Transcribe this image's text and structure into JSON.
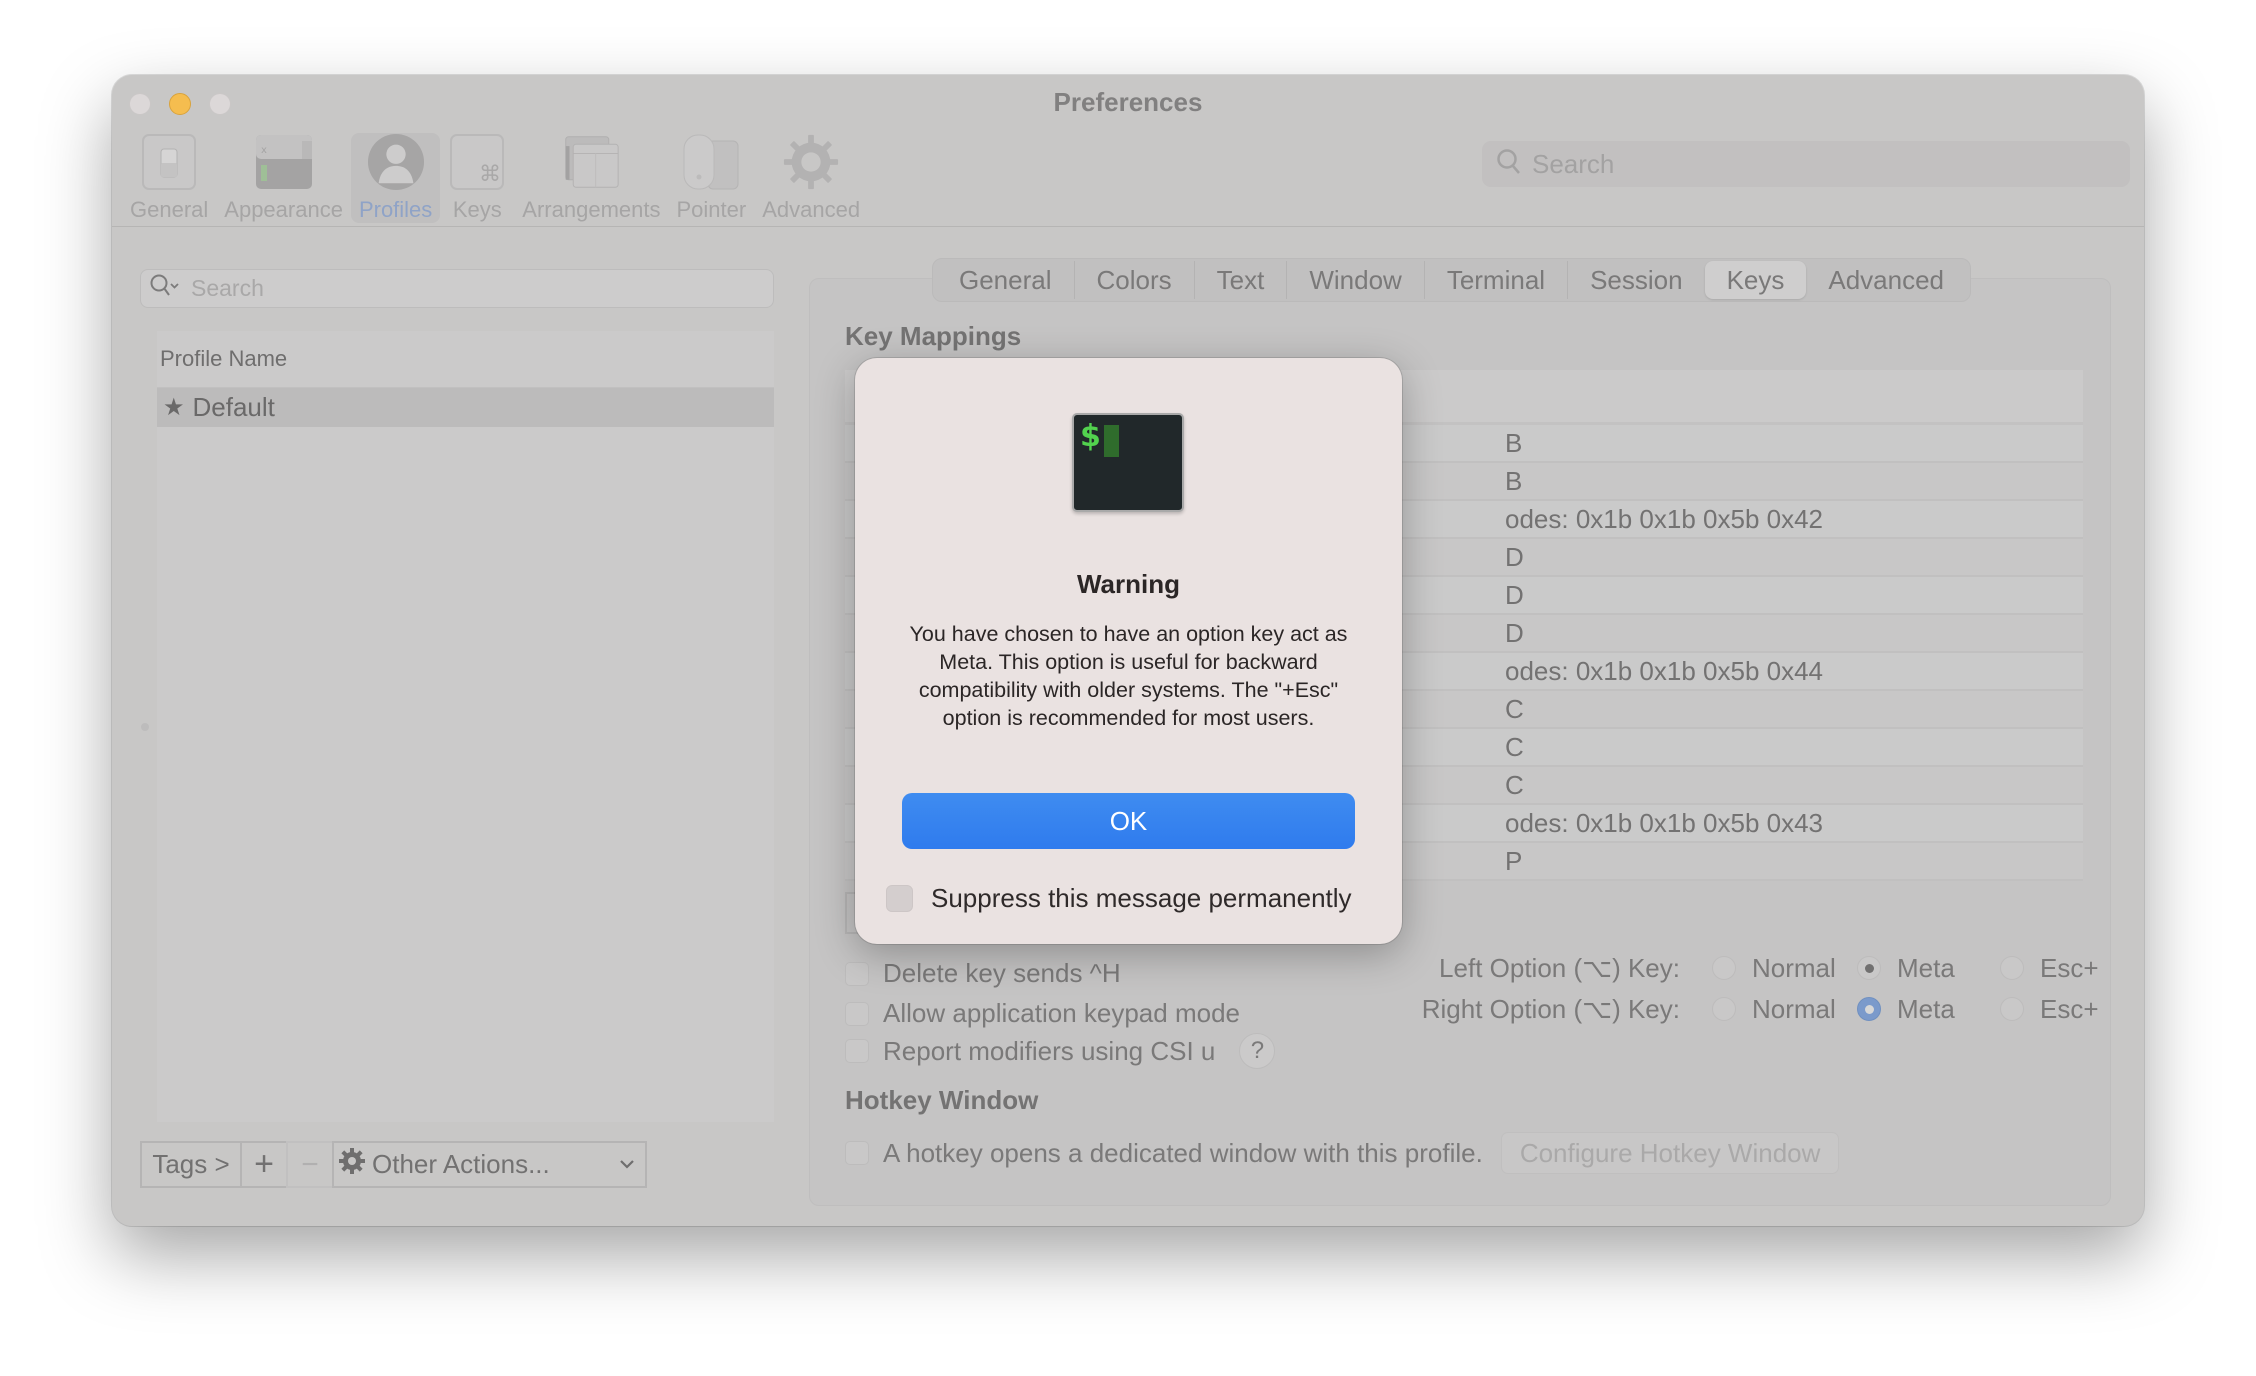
{
  "window": {
    "title": "Preferences",
    "controls": [
      "close",
      "minimize",
      "maximize"
    ]
  },
  "toolbar": {
    "items": [
      {
        "label": "General",
        "icon": "general-switch-icon",
        "active": false
      },
      {
        "label": "Appearance",
        "icon": "appearance-window-icon",
        "active": false
      },
      {
        "label": "Profiles",
        "icon": "profile-person-icon",
        "active": true
      },
      {
        "label": "Keys",
        "icon": "command-key-icon",
        "active": false
      },
      {
        "label": "Arrangements",
        "icon": "arrangements-windows-icon",
        "active": false
      },
      {
        "label": "Pointer",
        "icon": "mouse-pointer-icon",
        "active": false
      },
      {
        "label": "Advanced",
        "icon": "gear-icon",
        "active": false
      }
    ],
    "search_placeholder": "Search"
  },
  "profiles_panel": {
    "search_placeholder": "Search",
    "column_header": "Profile Name",
    "profiles": [
      {
        "name": "Default",
        "is_default": true,
        "selected": true
      }
    ],
    "bottom_bar": {
      "tags_label": "Tags >",
      "add_label": "+",
      "remove_label": "−",
      "other_actions_label": "Other Actions..."
    }
  },
  "settings_panel": {
    "tabs": [
      {
        "label": "General",
        "active": false
      },
      {
        "label": "Colors",
        "active": false
      },
      {
        "label": "Text",
        "active": false
      },
      {
        "label": "Window",
        "active": false
      },
      {
        "label": "Terminal",
        "active": false
      },
      {
        "label": "Session",
        "active": false
      },
      {
        "label": "Keys",
        "active": true
      },
      {
        "label": "Advanced",
        "active": false
      }
    ],
    "key_mappings": {
      "title": "Key Mappings",
      "visible_action_fragments": [
        "B",
        "B",
        "odes: 0x1b 0x1b 0x5b 0x42",
        "D",
        "D",
        "D",
        "odes: 0x1b 0x1b 0x5b 0x44",
        "C",
        "C",
        "C",
        "odes: 0x1b 0x1b 0x5b 0x43",
        "P"
      ]
    },
    "checkboxes": [
      {
        "label": "Delete key sends ^H",
        "checked": false
      },
      {
        "label": "Allow application keypad mode",
        "checked": false
      },
      {
        "label": "Report modifiers using CSI u",
        "checked": false
      }
    ],
    "help_label": "?",
    "option_keys": [
      {
        "label": "Left Option (⌥) Key:",
        "options": [
          "Normal",
          "Meta",
          "Esc+"
        ],
        "selected": "Meta"
      },
      {
        "label": "Right Option (⌥) Key:",
        "options": [
          "Normal",
          "Meta",
          "Esc+"
        ],
        "selected": "Meta"
      }
    ],
    "hotkey": {
      "title": "Hotkey Window",
      "checkbox_label": "A hotkey opens a dedicated window with this profile.",
      "checked": false,
      "configure_button": "Configure Hotkey Window"
    }
  },
  "dialog": {
    "icon": "terminal-app-icon",
    "icon_prompt": "$",
    "title": "Warning",
    "message": "You have chosen to have an option key act as Meta. This option is useful for backward compatibility with older systems. The \"+Esc\" option is recommended for most users.",
    "ok_label": "OK",
    "suppress_label": "Suppress this message permanently",
    "suppress_checked": false
  },
  "colors": {
    "accent_blue": "#3584ef",
    "minimize_yellow": "#f5bd4f",
    "terminal_green": "#52d24e"
  }
}
